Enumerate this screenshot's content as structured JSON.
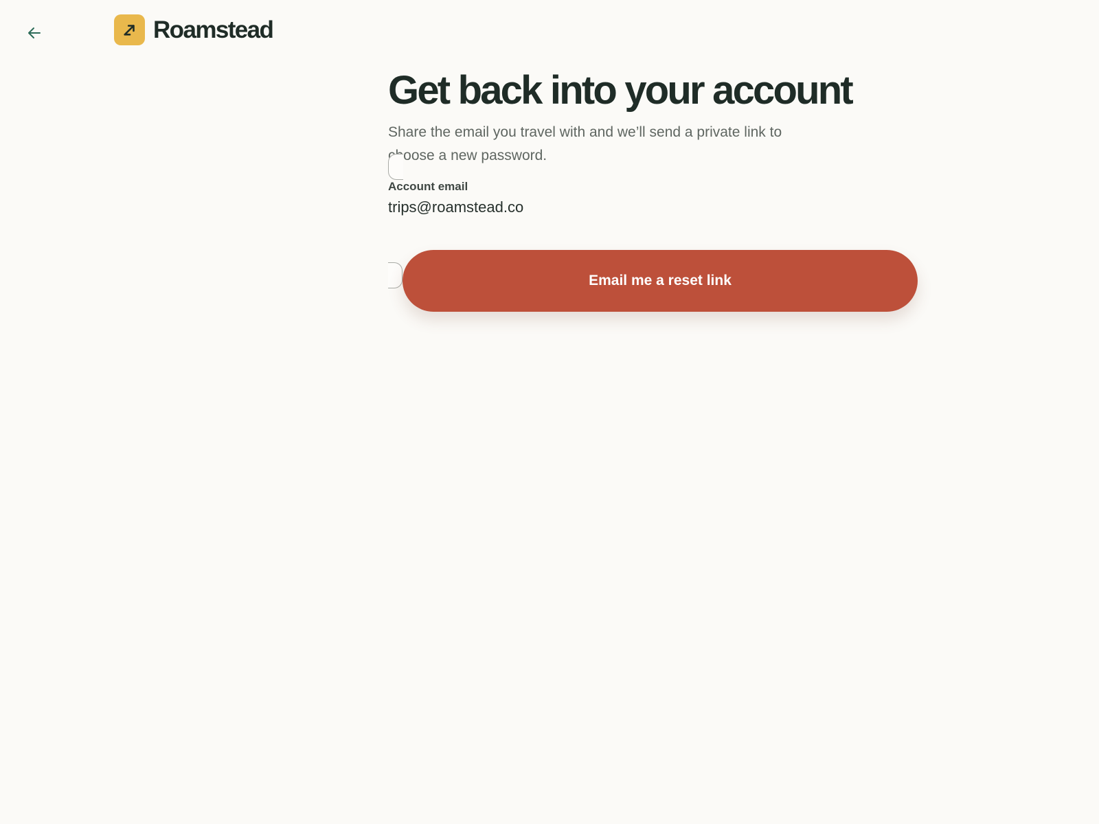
{
  "brand": {
    "name": "Roamstead",
    "mark_icon": "arrow-diagonal-icon",
    "mark_color": "#e9b84c"
  },
  "nav": {
    "back_icon": "arrow-left-icon",
    "back_color": "#2c6b58"
  },
  "page": {
    "title": "Get back into your account",
    "subtitle": "Share the email you travel with and we’ll send a private link to choose a new password."
  },
  "form": {
    "email_label": "Account email",
    "email_value": "trips@roamstead.co",
    "submit_label": "Email me a reset link"
  },
  "colors": {
    "background": "#fbfaf7",
    "text": "#1f2c27",
    "accent": "#bd503a"
  }
}
